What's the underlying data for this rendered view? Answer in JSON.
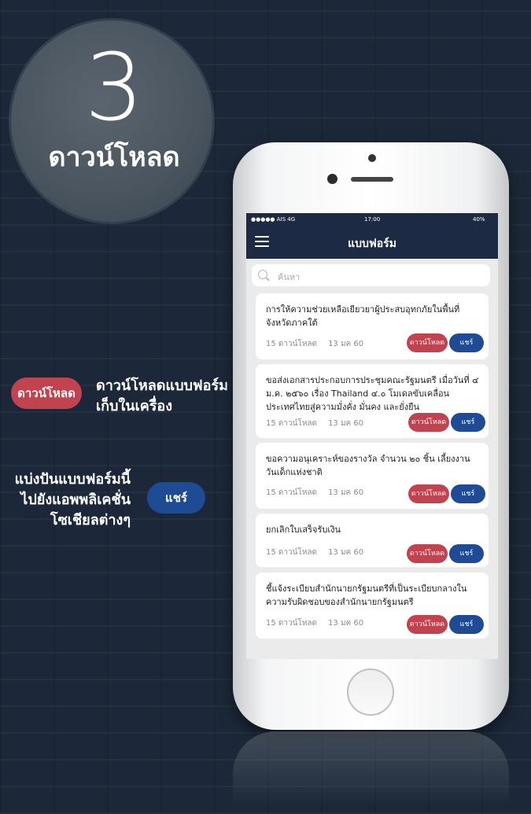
{
  "promo": {
    "step_number": "3",
    "step_label": "ดาวน์โหลด",
    "download_pill_label": "ดาวน์โหลด",
    "download_desc_line1": "ดาวน์โหลดแบบฟอร์ม",
    "download_desc_line2": "เก็บในเครื่อง",
    "share_desc_line1": "แบ่งปันแบบฟอร์มนี้",
    "share_desc_line2": "ไปยังแอพพลิเคชั่น",
    "share_desc_line3": "โซเชียลต่างๆ",
    "share_pill_label": "แชร์"
  },
  "status_bar": {
    "carrier": "●●●●● AIS  4G",
    "time": "17:00",
    "battery": "40%"
  },
  "header": {
    "title": "แบบฟอร์ม"
  },
  "search": {
    "placeholder": "ค้นหา"
  },
  "cards": [
    {
      "title": "การให้ความช่วยเหลือเยียวยาผู้ประสบอุทกภัยในพื้นที่จังหวัดภาคใต้",
      "downloads": "15 ดาวน์โหลด",
      "date": "13 มค 60",
      "download_label": "ดาวน์โหลด",
      "share_label": "แชร์"
    },
    {
      "title": "ขอส่งเอกสารประกอบการประชุมคณะรัฐมนตรี เมื่อวันที่ ๔ ม.ค. ๒๕๖๐ เรื่อง Thailand ๔.๐ โมเดลขับเคลื่อนประเทศไทยสู่ความมั่งคั่ง มั่นคง และยั่งยืน",
      "downloads": "15 ดาวน์โหลด",
      "date": "13 มค 60",
      "download_label": "ดาวน์โหลด",
      "share_label": "แชร์"
    },
    {
      "title": "ขอความอนุเคราะห์ของรางวัล จำนวน ๒๐ ชิ้น เลี้ยงงานวันเด็กแห่งชาติ",
      "downloads": "15 ดาวน์โหลด",
      "date": "13 มค 60",
      "download_label": "ดาวน์โหลด",
      "share_label": "แชร์"
    },
    {
      "title": "ยกเลิกใบเสร็จรับเงิน",
      "downloads": "15 ดาวน์โหลด",
      "date": "13 มค 60",
      "download_label": "ดาวน์โหลด",
      "share_label": "แชร์"
    },
    {
      "title": "ชี้แจ้งระเบียบสำนักนายกรัฐมนตรีที่เป็นระเบียบกลางในความรับผิดชอบของสำนักนายกรัฐมนตรี",
      "downloads": "15 ดาวน์โหลด",
      "date": "13 มค 60",
      "download_label": "ดาวน์โหลด",
      "share_label": "แชร์"
    }
  ],
  "colors": {
    "background": "#1c2839",
    "header": "#1c2a44",
    "download": "#c0434f",
    "share": "#1f4a94"
  }
}
